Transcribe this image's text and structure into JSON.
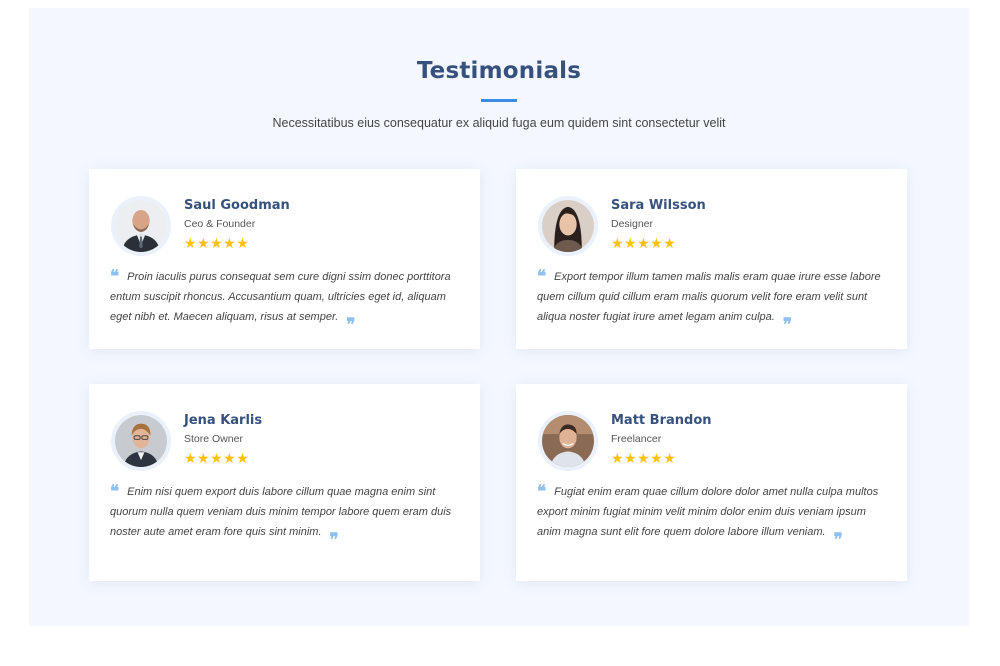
{
  "section": {
    "title": "Testimonials",
    "subtitle": "Necessitatibus eius consequatur ex aliquid fuga eum quidem sint consectetur velit"
  },
  "colors": {
    "heading": "#37517e",
    "accent": "#3b8beb",
    "star": "#ffc107",
    "quote_mark": "#8fc0ee",
    "section_bg": "#f4f8fe"
  },
  "testimonials": [
    {
      "name": "Saul Goodman",
      "role": "Ceo & Founder",
      "stars": "★★★★★",
      "rating": 5,
      "quote": "Proin iaculis purus consequat sem cure digni ssim donec porttitora entum suscipit rhoncus. Accusantium quam, ultricies eget id, aliquam eget nibh et. Maecen aliquam, risus at semper."
    },
    {
      "name": "Sara Wilsson",
      "role": "Designer",
      "stars": "★★★★★",
      "rating": 5,
      "quote": "Export tempor illum tamen malis malis eram quae irure esse labore quem cillum quid cillum eram malis quorum velit fore eram velit sunt aliqua noster fugiat irure amet legam anim culpa."
    },
    {
      "name": "Jena Karlis",
      "role": "Store Owner",
      "stars": "★★★★★",
      "rating": 5,
      "quote": "Enim nisi quem export duis labore cillum quae magna enim sint quorum nulla quem veniam duis minim tempor labore quem eram duis noster aute amet eram fore quis sint minim."
    },
    {
      "name": "Matt Brandon",
      "role": "Freelancer",
      "stars": "★★★★★",
      "rating": 5,
      "quote": "Fugiat enim eram quae cillum dolore dolor amet nulla culpa multos export minim fugiat minim velit minim dolor enim duis veniam ipsum anim magna sunt elit fore quem dolore labore illum veniam."
    }
  ],
  "icons": {
    "quote_left": "quote-left-icon",
    "quote_right": "quote-right-icon",
    "star": "star-icon"
  }
}
